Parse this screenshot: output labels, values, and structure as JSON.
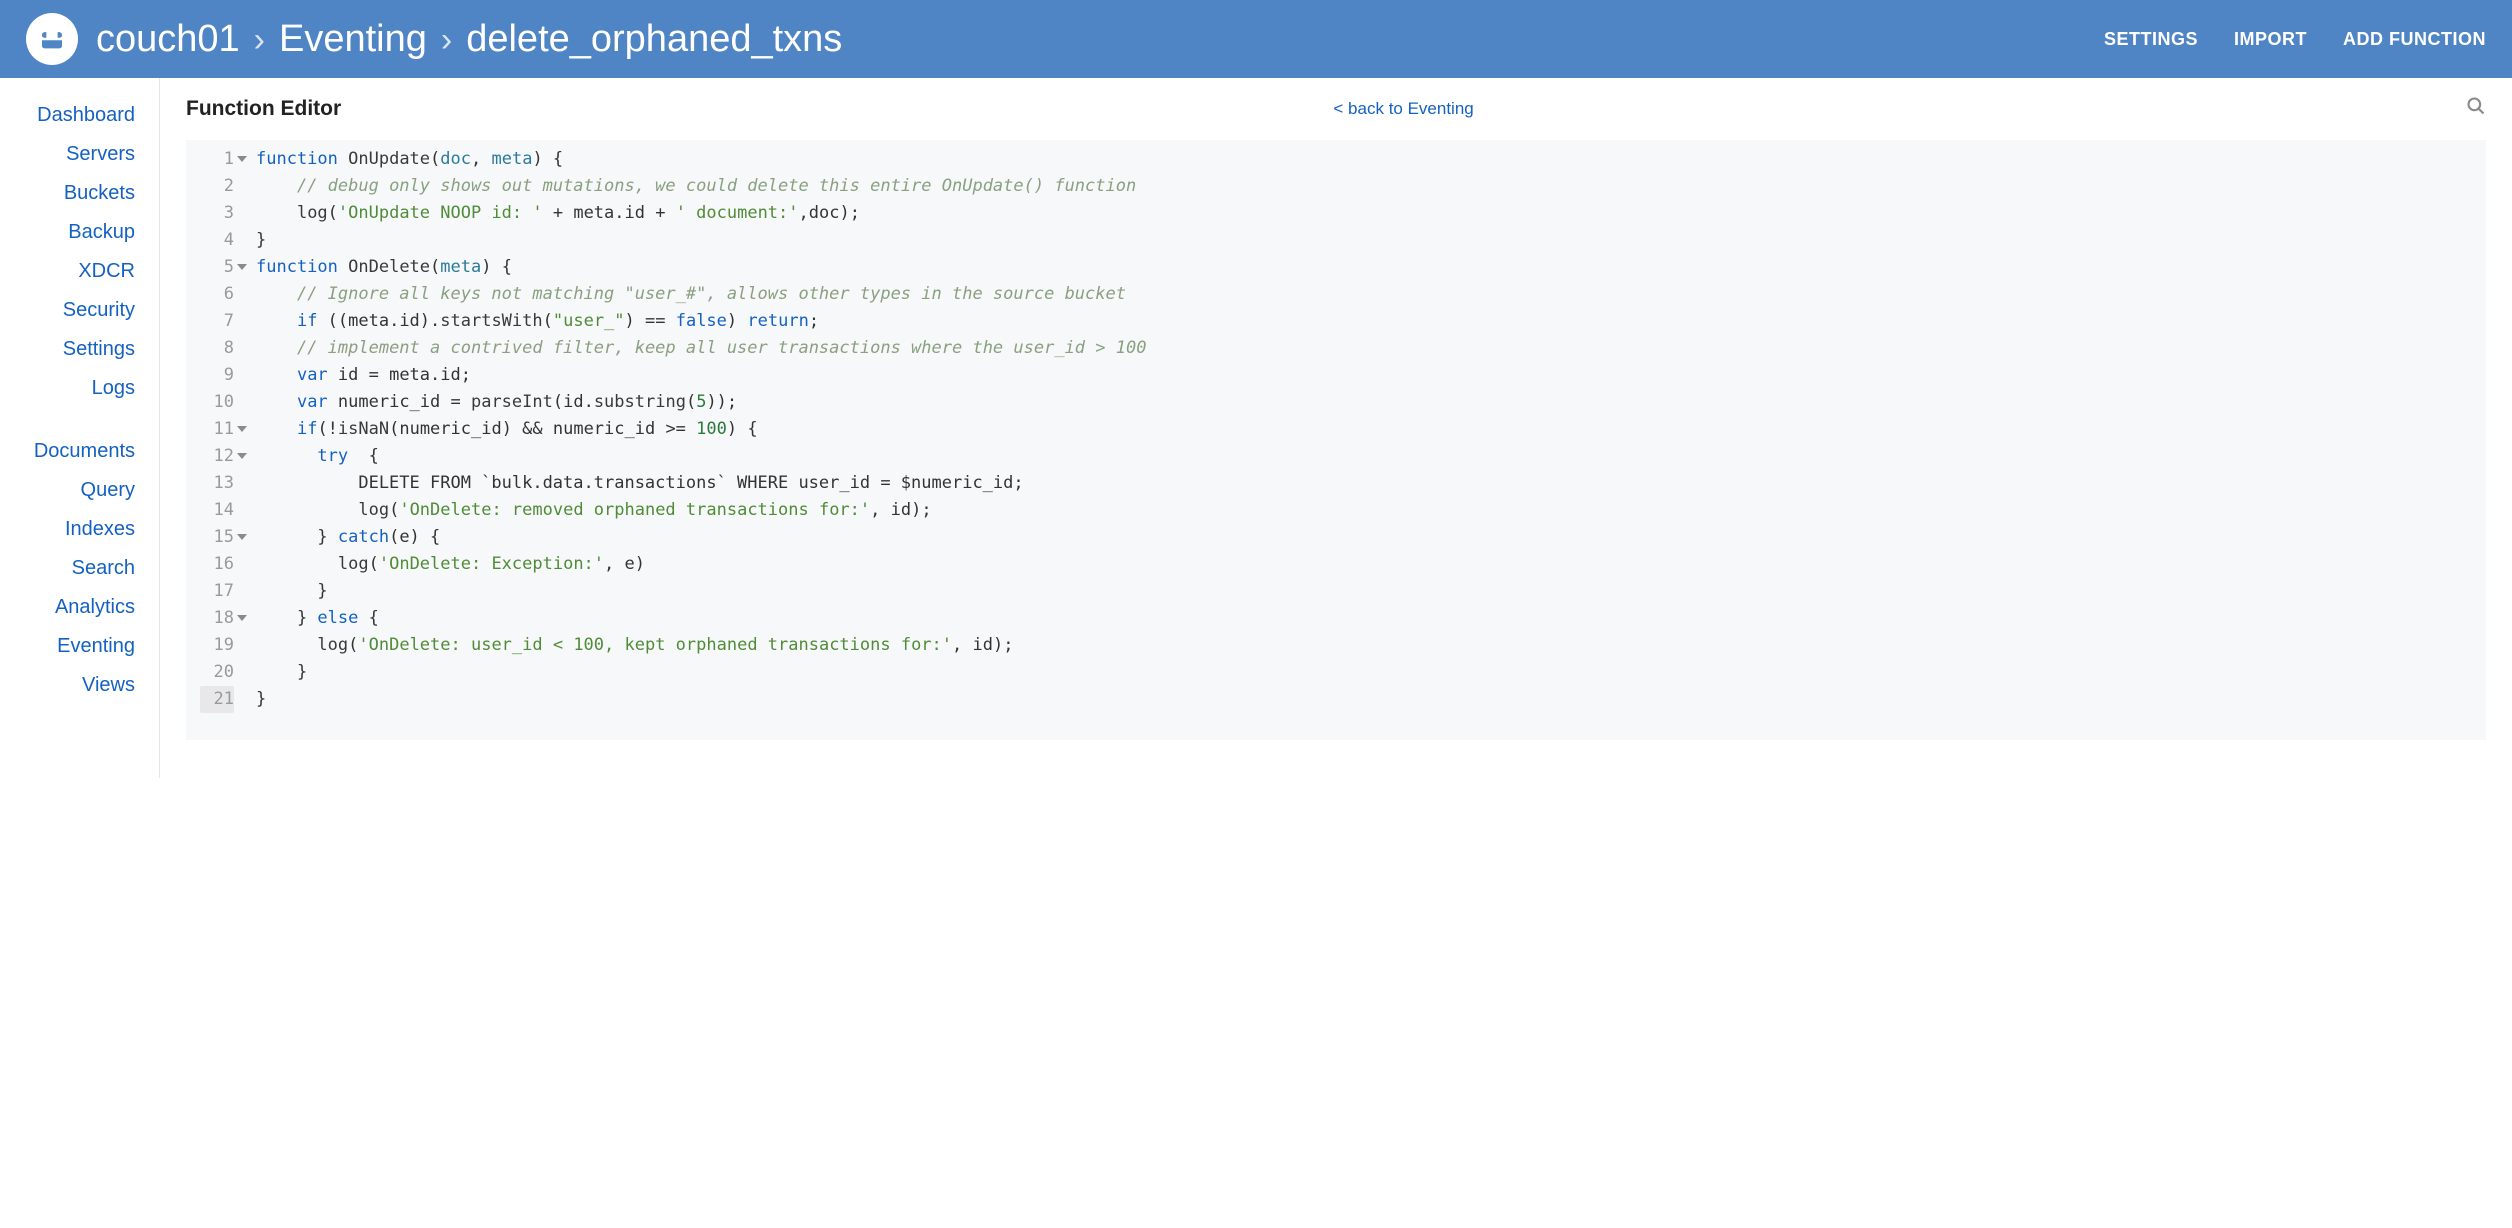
{
  "header": {
    "breadcrumb": [
      "couch01",
      "Eventing",
      "delete_orphaned_txns"
    ],
    "actions": [
      "SETTINGS",
      "IMPORT",
      "ADD FUNCTION"
    ]
  },
  "sidebar": {
    "groups": [
      [
        "Dashboard",
        "Servers",
        "Buckets",
        "Backup",
        "XDCR",
        "Security",
        "Settings",
        "Logs"
      ],
      [
        "Documents",
        "Query",
        "Indexes",
        "Search",
        "Analytics",
        "Eventing",
        "Views"
      ]
    ]
  },
  "main": {
    "title": "Function Editor",
    "back_label": "< back to Eventing"
  },
  "code": {
    "foldable_lines": [
      1,
      5,
      11,
      12,
      15,
      18
    ],
    "current_line": 21,
    "lines": [
      [
        [
          "kw",
          "function"
        ],
        [
          "",
          " "
        ],
        [
          "fn",
          "OnUpdate"
        ],
        [
          "",
          "("
        ],
        [
          "id2",
          "doc"
        ],
        [
          "",
          ", "
        ],
        [
          "id2",
          "meta"
        ],
        [
          "",
          ") {"
        ]
      ],
      [
        [
          "",
          "    "
        ],
        [
          "cm",
          "// debug only shows out mutations, we could delete this entire OnUpdate() function"
        ]
      ],
      [
        [
          "",
          "    "
        ],
        [
          "fn",
          "log"
        ],
        [
          "",
          "("
        ],
        [
          "str",
          "'OnUpdate NOOP id: '"
        ],
        [
          "",
          " + meta.id + "
        ],
        [
          "str",
          "' document:'"
        ],
        [
          "",
          ",doc);"
        ]
      ],
      [
        [
          "",
          "}"
        ]
      ],
      [
        [
          "kw",
          "function"
        ],
        [
          "",
          " "
        ],
        [
          "fn",
          "OnDelete"
        ],
        [
          "",
          "("
        ],
        [
          "id2",
          "meta"
        ],
        [
          "",
          ") {"
        ]
      ],
      [
        [
          "",
          "    "
        ],
        [
          "cm",
          "// Ignore all keys not matching \"user_#\", allows other types in the source bucket"
        ]
      ],
      [
        [
          "",
          "    "
        ],
        [
          "kw",
          "if"
        ],
        [
          "",
          " ((meta.id)."
        ],
        [
          "fn",
          "startsWith"
        ],
        [
          "",
          "("
        ],
        [
          "str",
          "\"user_\""
        ],
        [
          "",
          ") == "
        ],
        [
          "bool",
          "false"
        ],
        [
          "",
          ") "
        ],
        [
          "kw",
          "return"
        ],
        [
          "",
          ";"
        ]
      ],
      [
        [
          "",
          "    "
        ],
        [
          "cm",
          "// implement a contrived filter, keep all user transactions where the user_id > 100"
        ]
      ],
      [
        [
          "",
          "    "
        ],
        [
          "kw",
          "var"
        ],
        [
          "",
          " id = meta.id;"
        ]
      ],
      [
        [
          "",
          "    "
        ],
        [
          "kw",
          "var"
        ],
        [
          "",
          " numeric_id = "
        ],
        [
          "fn",
          "parseInt"
        ],
        [
          "",
          "(id."
        ],
        [
          "fn",
          "substring"
        ],
        [
          "",
          "("
        ],
        [
          "num",
          "5"
        ],
        [
          "",
          "));"
        ]
      ],
      [
        [
          "",
          "    "
        ],
        [
          "kw",
          "if"
        ],
        [
          "",
          "(!"
        ],
        [
          "fn",
          "isNaN"
        ],
        [
          "",
          "(numeric_id) && numeric_id >= "
        ],
        [
          "num",
          "100"
        ],
        [
          "",
          ") {"
        ]
      ],
      [
        [
          "",
          "      "
        ],
        [
          "kw",
          "try"
        ],
        [
          "",
          "  {"
        ]
      ],
      [
        [
          "",
          "          DELETE FROM `bulk.data.transactions` WHERE user_id = $numeric_id;"
        ]
      ],
      [
        [
          "",
          "          "
        ],
        [
          "fn",
          "log"
        ],
        [
          "",
          "("
        ],
        [
          "str",
          "'OnDelete: removed orphaned transactions for:'"
        ],
        [
          "",
          ", id);"
        ]
      ],
      [
        [
          "",
          "      } "
        ],
        [
          "kw",
          "catch"
        ],
        [
          "",
          "(e) {"
        ]
      ],
      [
        [
          "",
          "        "
        ],
        [
          "fn",
          "log"
        ],
        [
          "",
          "("
        ],
        [
          "str",
          "'OnDelete: Exception:'"
        ],
        [
          "",
          ", e)"
        ]
      ],
      [
        [
          "",
          "      }"
        ]
      ],
      [
        [
          "",
          "    } "
        ],
        [
          "kw",
          "else"
        ],
        [
          "",
          " {"
        ]
      ],
      [
        [
          "",
          "      "
        ],
        [
          "fn",
          "log"
        ],
        [
          "",
          "("
        ],
        [
          "str",
          "'OnDelete: user_id < 100, kept orphaned transactions for:'"
        ],
        [
          "",
          ", id);"
        ]
      ],
      [
        [
          "",
          "    }"
        ]
      ],
      [
        [
          "",
          "}"
        ]
      ]
    ]
  }
}
